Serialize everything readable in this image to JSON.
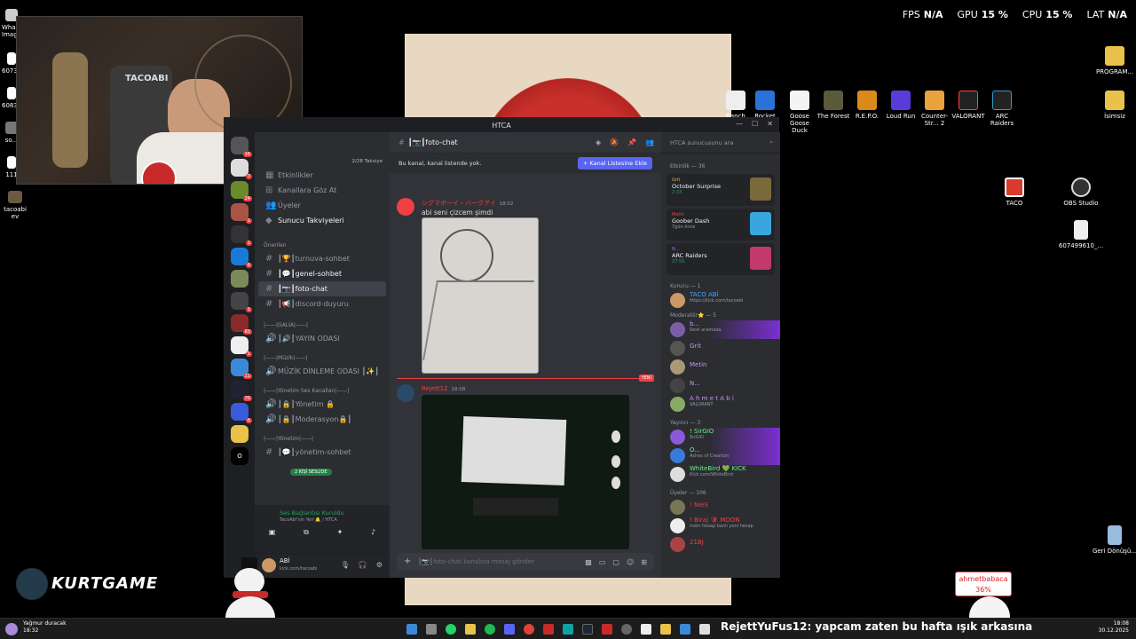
{
  "osd": {
    "fps_label": "FPS",
    "fps": "N/A",
    "gpu_label": "GPU",
    "gpu": "15 %",
    "cpu_label": "CPU",
    "cpu": "15 %",
    "lat_label": "LAT",
    "lat": "N/A"
  },
  "desktop_right": [
    {
      "label": "PROGRAM...",
      "color": "#e8c24a"
    },
    {
      "label": "İsimsiz",
      "color": "#e8c24a"
    },
    {
      "label": "TACO",
      "color": "#d93a2b"
    },
    {
      "label": "OBS Studio",
      "color": "#444"
    },
    {
      "label": "607499610_...",
      "color": "#eee"
    },
    {
      "label": "Geri Dönüşü...",
      "color": "#9bd"
    }
  ],
  "desktop_games": [
    "Ranch",
    "Rocket League®",
    "Goose Goose Duck",
    "The Forest",
    "R.E.P.O.",
    "Loud Run",
    "Counter-Str... 2",
    "VALORANT",
    "ARC Raiders"
  ],
  "desktop_left": [
    "Wha... Image",
    "60738...",
    "60831...",
    "so...",
    "111",
    "tacoabi ev"
  ],
  "webcam": {
    "overlay_text": "TACOABI"
  },
  "discord": {
    "window_title": "HTCA",
    "boost": "2/28 Takviye",
    "nav": [
      "Etkinlikler",
      "Kanallara Göz At",
      "Üyeler",
      "Sunucu Takviyeleri"
    ],
    "suggested_header": "Önerilen",
    "channels_top": [
      {
        "name": "┃🏆┃turnuva-sohbet",
        "state": "normal"
      },
      {
        "name": "┃💬┃genel-sohbet",
        "state": "bold"
      },
      {
        "name": "┃📷┃foto-chat",
        "state": "active"
      },
      {
        "name": "┃📢┃discord-duyuru",
        "state": "normal"
      }
    ],
    "cat_galia": "|——|GALİA|——|",
    "voice_yayin": "┃🔊┃YAYIN ODASI",
    "cat_muzik": "|——|Müzik|——|",
    "voice_muzik": "MÜZİK DİNLEME ODASI ┃✨┃",
    "cat_yonetim_ses": "|——|Yönetim Ses Kanalları|——|",
    "voice_yonetim": "┃🔒┃Yönetim 🔒",
    "voice_mod": "┃🔒┃Moderasyon🔒┃",
    "cat_yonetim": "|——|Yönetim|——|",
    "text_yonetim": "┃💬┃yönetim-sohbet",
    "voice_pill": "2 KİŞİ SESLİDE",
    "voice_connected": "Ses Bağlantısı Kuruldu",
    "voice_sub": "TacoAbi'nin Yeri 🔔 / HTCA",
    "user_name": "ABİ",
    "user_sub": "kick.com/tacoabi",
    "channel_title": "┃📷┃foto-chat",
    "banner_text": "Bu kanal, kanal listende yok.",
    "banner_button": "+ Kanal Listesine Ekle",
    "msg1": {
      "author": "シグマボーイ・バークアイ",
      "time": "18:02",
      "text": "abi seni çizcem şimdi"
    },
    "new_label": "YENİ",
    "msg2": {
      "author": "Rejett12",
      "time": "18:08"
    },
    "composer_placeholder": "┃📷┃foto-chat kanalına mesaj gönder",
    "search_placeholder": "HTCA sunucusunu ara",
    "events_header": "Etkinlik — 36",
    "activities": [
      {
        "user": "Grit",
        "game": "October Surprise",
        "meta": "2:33",
        "color": "#7a6a3a"
      },
      {
        "user": "Metin",
        "game": "Goober Dash",
        "meta": "7gün önce",
        "color": "#3aa6e0"
      },
      {
        "user": "N...",
        "game": "ARC Raiders",
        "meta": "27:50",
        "color": "#c23a6a"
      }
    ],
    "founder_header": "Kurucu — 1",
    "founder": {
      "name": "TACO ABİ",
      "sub": "https://kick.com/tacoabi"
    },
    "mods_header": "Moderatör⭐ — 5",
    "mods": [
      {
        "name": "b...",
        "sub": "Sesli aramada",
        "color": "#a96de0"
      },
      {
        "name": "Grit",
        "sub": "",
        "color": "#a96de0"
      },
      {
        "name": "Metin",
        "sub": "",
        "color": "#a96de0"
      },
      {
        "name": "N...",
        "sub": "",
        "color": "#a96de0"
      },
      {
        "name": "A h m e t A b i",
        "sub": "VALORANT",
        "color": "#a96de0"
      }
    ],
    "streamers_header": "Yayıncı — 3",
    "streamers": [
      {
        "name": "! SirGIO",
        "sub": "SirGIO",
        "color": "#3ddc84"
      },
      {
        "name": "O...",
        "sub": "Ashes of Creation",
        "color": "#3ddc84"
      },
      {
        "name": "WhiteBird 💚 KICK",
        "sub": "Kick.com/WhiteBird",
        "color": "#3ddc84"
      }
    ],
    "users_header": "Üyeler — 106",
    "users": [
      {
        "name": "! NieS",
        "sub": "",
        "color": "#f23f43"
      },
      {
        "name": "! Biraj 🛡 MOON",
        "sub": "main hesap banlı yeni hesap",
        "color": "#f23f43"
      },
      {
        "name": "21BJ",
        "sub": "",
        "color": "#f23f43"
      }
    ]
  },
  "donation": {
    "name": "ahmetbabaca",
    "percent": "36%"
  },
  "logo": "KURTGAME",
  "ticker": {
    "user": "RejettYuFus12",
    "text": ": yapcam zaten bu hafta ışık arkasına"
  },
  "weather": {
    "line1": "Yağmur duracak",
    "line2": "18:32"
  },
  "clock": {
    "time": "18:08",
    "date": "30.12.2025"
  }
}
